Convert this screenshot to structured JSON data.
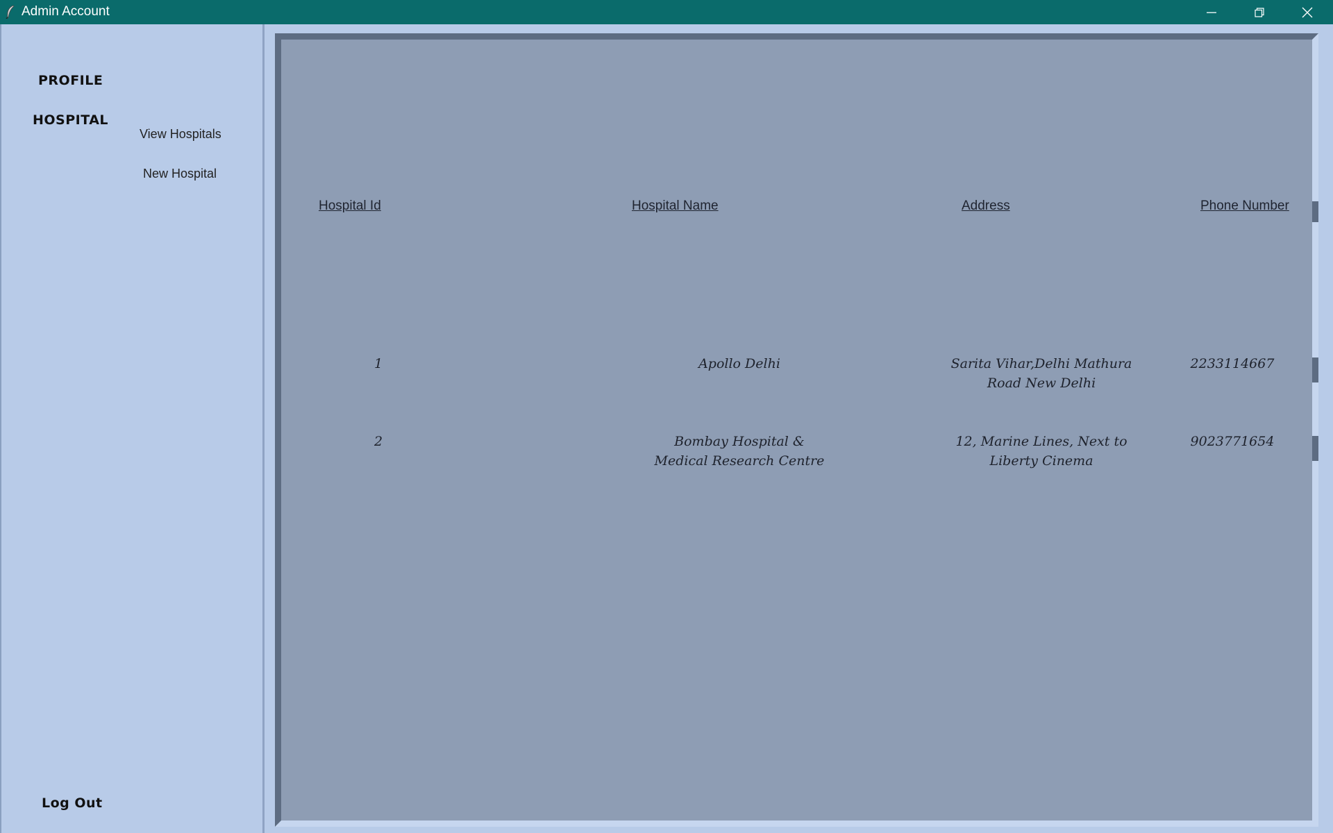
{
  "window": {
    "title": "Admin Account"
  },
  "sidebar": {
    "profile_label": "PROFILE",
    "hospital_label": "HOSPITAL",
    "view_hospitals_label": "View Hospitals",
    "new_hospital_label": "New Hospital",
    "logout_label": "Log Out"
  },
  "table": {
    "headers": {
      "id": "Hospital Id",
      "name": "Hospital Name",
      "address": "Address",
      "phone": "Phone Number"
    },
    "rows": [
      {
        "id": "1",
        "name": "Apollo Delhi",
        "address": "Sarita Vihar,Delhi Mathura Road New Delhi",
        "phone": "2233114667"
      },
      {
        "id": "2",
        "name": "Bombay Hospital & Medical Research Centre",
        "address": "12, Marine Lines, Next to Liberty Cinema",
        "phone": "9023771654"
      }
    ]
  }
}
